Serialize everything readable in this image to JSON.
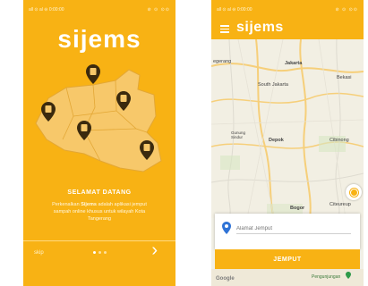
{
  "screen1": {
    "status": {
      "left": "all ⊙ al ⊖ 0:00:00",
      "right": "⊘ ⊙ ⊙⊙"
    },
    "logo": "sijems",
    "welcome_title": "SELAMAT DATANG",
    "welcome_desc_bold": "Sijems",
    "welcome_desc_pre": "Perkenalkan ",
    "welcome_desc_post": " adalah aplikasi jemput sampah online khusus untuk wilayah Kota Tangerang",
    "skip_label": "skip",
    "next_glyph": "›",
    "dots_total": 3,
    "dots_active": 1,
    "colors": {
      "primary": "#f8b214"
    }
  },
  "screen2": {
    "status": {
      "left": "all ⊙ al ⊖ 0:00:00",
      "right": "⊘ ⊙ ⊙⊙"
    },
    "logo": "sijems",
    "map_labels": {
      "jakarta": "Jakarta",
      "south_jakarta": "South Jakarta",
      "bekasi": "Bekasi",
      "depok": "Depok",
      "tangerang": "egerang",
      "gunung": "Gunung Sindur",
      "cibinong": "Cibinong",
      "bogor": "Bogor",
      "citeureup": "Citeureup"
    },
    "address_placeholder": "Alamat Jemput",
    "jemput_label": "JEMPUT",
    "google_logo": "Google",
    "footer_label": "Pengunjungan",
    "colors": {
      "primary": "#f8b214",
      "pin": "#2f73d6"
    }
  }
}
